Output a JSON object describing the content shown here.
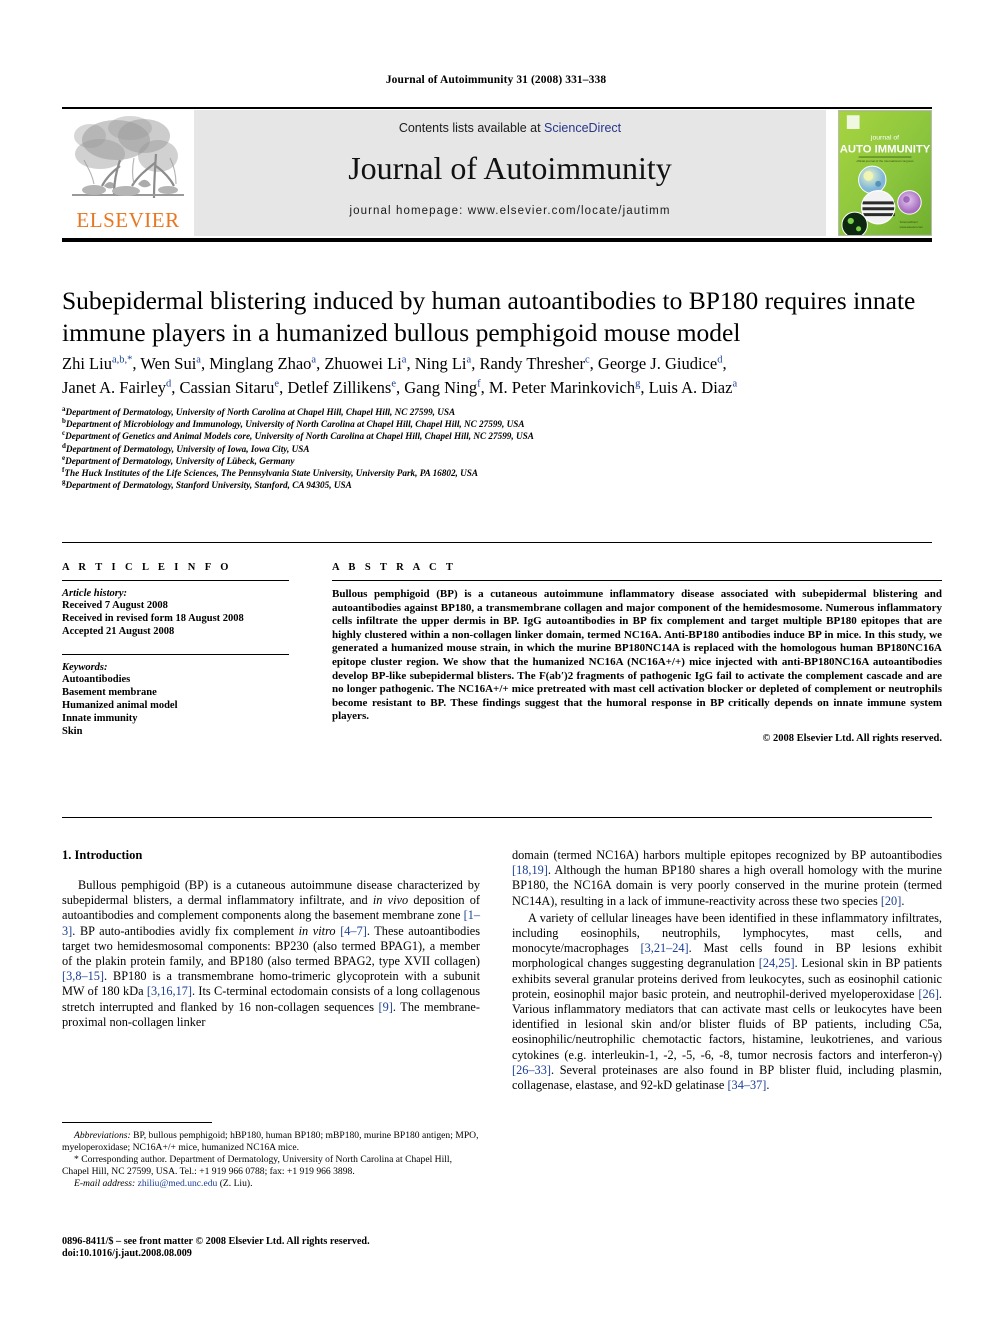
{
  "running_head": "Journal of Autoimmunity 31 (2008) 331–338",
  "masthead": {
    "contents_prefix": "Contents lists available at ",
    "sciencedirect": "ScienceDirect",
    "journal_title": "Journal of Autoimmunity",
    "homepage": "journal homepage: www.elsevier.com/locate/jautimm",
    "publisher": "ELSEVIER",
    "cover": {
      "line1": "journal of",
      "line2": "AUTO IMMUNITY",
      "line3": "official journal of the international congress on autoimmunity",
      "accent": "#8dc63f"
    },
    "link_color": "#28358a"
  },
  "article": {
    "title": "Subepidermal blistering induced by human autoantibodies to BP180 requires innate immune players in a humanized bullous pemphigoid mouse model",
    "authors_line1_parts": [
      {
        "name": "Zhi Liu",
        "sup": "a,b,*"
      },
      {
        "name": "Wen Sui",
        "sup": "a"
      },
      {
        "name": "Minglang Zhao",
        "sup": "a"
      },
      {
        "name": "Zhuowei Li",
        "sup": "a"
      },
      {
        "name": "Ning Li",
        "sup": "a"
      },
      {
        "name": "Randy Thresher",
        "sup": "c"
      },
      {
        "name": "George J. Giudice",
        "sup": "d"
      }
    ],
    "authors_line2_parts": [
      {
        "name": "Janet A. Fairley",
        "sup": "d"
      },
      {
        "name": "Cassian Sitaru",
        "sup": "e"
      },
      {
        "name": "Detlef Zillikens",
        "sup": "e"
      },
      {
        "name": "Gang Ning",
        "sup": "f"
      },
      {
        "name": "M. Peter Marinkovich",
        "sup": "g"
      },
      {
        "name": "Luis A. Diaz",
        "sup": "a"
      }
    ],
    "affiliations": [
      {
        "mark": "a",
        "text": "Department of Dermatology, University of North Carolina at Chapel Hill, Chapel Hill, NC 27599, USA"
      },
      {
        "mark": "b",
        "text": "Department of Microbiology and Immunology, University of North Carolina at Chapel Hill, Chapel Hill, NC 27599, USA"
      },
      {
        "mark": "c",
        "text": "Department of Genetics and Animal Models core, University of North Carolina at Chapel Hill, Chapel Hill, NC 27599, USA"
      },
      {
        "mark": "d",
        "text": "Department of Dermatology, University of Iowa, Iowa City, USA"
      },
      {
        "mark": "e",
        "text": "Department of Dermatology, University of Lübeck, Germany"
      },
      {
        "mark": "f",
        "text": "The Huck Institutes of the Life Sciences, The Pennsylvania State University, University Park, PA 16802, USA"
      },
      {
        "mark": "g",
        "text": "Department of Dermatology, Stanford University, Stanford, CA 94305, USA"
      }
    ]
  },
  "article_info": {
    "heading": "A R T I C L E  I N F O",
    "history_label": "Article history:",
    "history": [
      "Received 7 August 2008",
      "Received in revised form 18 August 2008",
      "Accepted 21 August 2008"
    ],
    "keywords_label": "Keywords:",
    "keywords": [
      "Autoantibodies",
      "Basement membrane",
      "Humanized animal model",
      "Innate immunity",
      "Skin"
    ]
  },
  "abstract": {
    "heading": "A B S T R A C T",
    "text": "Bullous pemphigoid (BP) is a cutaneous autoimmune inflammatory disease associated with subepidermal blistering and autoantibodies against BP180, a transmembrane collagen and major component of the hemidesmosome. Numerous inflammatory cells infiltrate the upper dermis in BP. IgG autoantibodies in BP fix complement and target multiple BP180 epitopes that are highly clustered within a non-collagen linker domain, termed NC16A. Anti-BP180 antibodies induce BP in mice. In this study, we generated a humanized mouse strain, in which the murine BP180NC14A is replaced with the homologous human BP180NC16A epitope cluster region. We show that the humanized NC16A (NC16A+/+) mice injected with anti-BP180NC16A autoantibodies develop BP-like subepidermal blisters. The F(ab′)2 fragments of pathogenic IgG fail to activate the complement cascade and are no longer pathogenic. The NC16A+/+ mice pretreated with mast cell activation blocker or depleted of complement or neutrophils become resistant to BP. These findings suggest that the humoral response in BP critically depends on innate immune system players.",
    "copyright": "© 2008 Elsevier Ltd. All rights reserved."
  },
  "introduction": {
    "heading": "1.  Introduction",
    "left_paragraph_1": "Bullous pemphigoid (BP) is a cutaneous autoimmune disease characterized by subepidermal blisters, a dermal inflammatory infiltrate, and in vivo deposition of autoantibodies and complement components along the basement membrane zone [1–3]. BP auto-antibodies avidly fix complement in vitro [4–7]. These autoantibodies target two hemidesmosomal components: BP230 (also termed BPAG1), a member of the plakin protein family, and BP180 (also termed BPAG2, type XVII collagen) [3,8–15]. BP180 is a transmembrane homo-trimeric glycoprotein with a subunit MW of 180 kDa [3,16,17]. Its C-terminal ectodomain consists of a long collagenous stretch interrupted and flanked by 16 non-collagen sequences [9]. The membrane-proximal non-collagen linker",
    "right_paragraph_1": "domain (termed NC16A) harbors multiple epitopes recognized by BP autoantibodies [18,19]. Although the human BP180 shares a high overall homology with the murine BP180, the NC16A domain is very poorly conserved in the murine protein (termed NC14A), resulting in a lack of immune-reactivity across these two species [20].",
    "right_paragraph_2": "A variety of cellular lineages have been identified in these inflammatory infiltrates, including eosinophils, neutrophils, lymphocytes, mast cells, and monocyte/macrophages [3,21–24]. Mast cells found in BP lesions exhibit morphological changes suggesting degranulation [24,25]. Lesional skin in BP patients exhibits several granular proteins derived from leukocytes, such as eosinophil cationic protein, eosinophil major basic protein, and neutrophil-derived myeloperoxidase [26]. Various inflammatory mediators that can activate mast cells or leukocytes have been identified in lesional skin and/or blister fluids of BP patients, including C5a, eosinophilic/neutrophilic chemotactic factors, histamine, leukotrienes, and various cytokines (e.g. interleukin-1, -2, -5, -6, -8, tumor necrosis factors and interferon-γ) [26–33]. Several proteinases are also found in BP blister fluid, including plasmin, collagenase, elastase, and 92-kD gelatinase [34–37]."
  },
  "footnotes": {
    "abbreviations_label": "Abbreviations:",
    "abbreviations": "BP, bullous pemphigoid; hBP180, human BP180; mBP180, murine BP180 antigen; MPO, myeloperoxidase; NC16A+/+ mice, humanized NC16A mice.",
    "corresponding": "* Corresponding author. Department of Dermatology, University of North Carolina at Chapel Hill, Chapel Hill, NC 27599, USA. Tel.: +1 919 966 0788; fax: +1 919 966 3898.",
    "email_label": "E-mail address:",
    "email": "zhiliu@med.unc.edu",
    "email_suffix": "(Z. Liu)."
  },
  "footer": {
    "issn_line": "0896-8411/$ – see front matter © 2008 Elsevier Ltd. All rights reserved.",
    "doi_line": "doi:10.1016/j.jaut.2008.08.009"
  }
}
